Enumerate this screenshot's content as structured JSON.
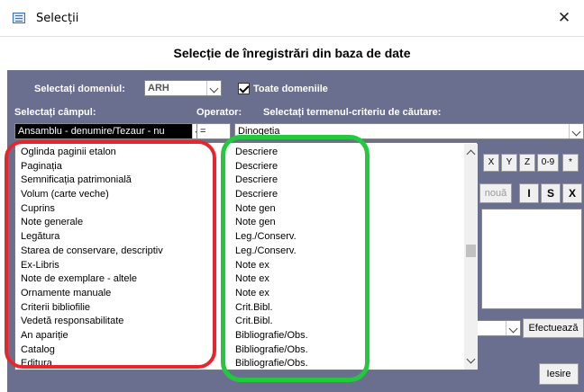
{
  "window": {
    "title": "Selecții",
    "close_glyph": "✕"
  },
  "heading": "Selecție de înregistrări din baza de date",
  "domain_label": "Selectați domeniul:",
  "domain_value": "ARH",
  "all_domains_label": "Toate domeniile",
  "all_domains_checked": true,
  "field_label": "Selectați câmpul:",
  "operator_label": "Operator:",
  "term_label": "Selectați termenul-criteriu de căutare:",
  "field_value": "Ansamblu - denumire/Tezaur - nu",
  "operator_value": "=",
  "term_value": "Dinogetia",
  "letter_buttons": [
    "X",
    "Y",
    "Z",
    "0-9",
    "*"
  ],
  "new_label": "nouă",
  "action_buttons": [
    "I",
    "S",
    "X"
  ],
  "execute_label": "Efectuează",
  "exit_label": "Iesire",
  "dropdown": {
    "fields": [
      "Oglinda paginii etalon",
      "Paginația",
      "Semnificația patrimonială",
      "Volum (carte veche)",
      "Cuprins",
      "Note generale",
      "Legătura",
      "Starea de conservare, descriptiv",
      "Ex-Libris",
      "Note de exemplare - altele",
      "Ornamente manuale",
      "Criterii bibliofilie",
      "Vedetă responsabilitate",
      "An apariție",
      "Catalog",
      "Editura"
    ],
    "groups": [
      "Descriere",
      "Descriere",
      "Descriere",
      "Descriere",
      "Note gen",
      "Note gen",
      "Leg./Conserv.",
      "Leg./Conserv.",
      "Note ex",
      "Note ex",
      "Note ex",
      "Crit.Bibl.",
      "Crit.Bibl.",
      "Bibliografie/Obs.",
      "Bibliografie/Obs.",
      "Bibliografie/Obs."
    ]
  },
  "colors": {
    "panel": "#6a6f90",
    "red_highlight": "#e6262f",
    "green_highlight": "#22c93c"
  }
}
